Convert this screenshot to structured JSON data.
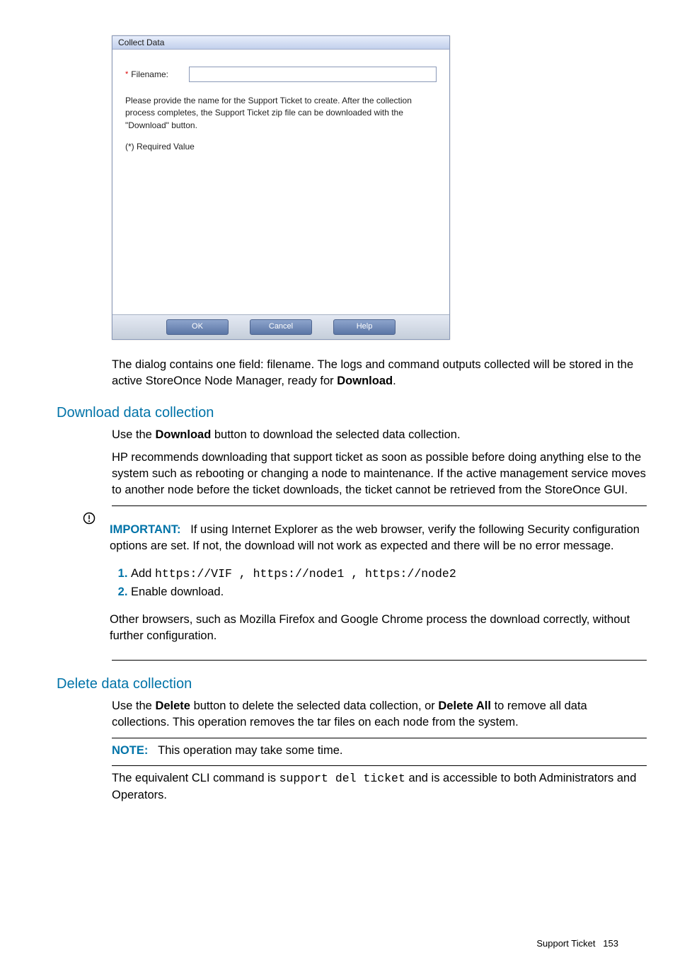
{
  "dialog": {
    "title": "Collect Data",
    "filename_label": "Filename:",
    "filename_value": "",
    "info": "Please provide the name for the Support Ticket to create. After the collection process completes, the Support Ticket zip file can be downloaded with the \"Download\" button.",
    "required_note": "(*) Required Value",
    "buttons": {
      "ok": "OK",
      "cancel": "Cancel",
      "help": "Help"
    }
  },
  "para_after_dialog_prefix": "The dialog contains one field: filename. The logs and command outputs collected will be stored in the active StoreOnce Node Manager, ready for ",
  "para_after_dialog_bold": "Download",
  "para_after_dialog_suffix": ".",
  "h_download": "Download data collection",
  "download_p1_a": "Use the ",
  "download_p1_bold": "Download",
  "download_p1_b": " button to download the selected data collection.",
  "download_p2": "HP recommends downloading that support ticket as soon as possible before doing anything else to the system such as rebooting or changing a node to maintenance. If the active management service moves to another node before the ticket downloads, the ticket cannot be retrieved from the StoreOnce GUI.",
  "important_label": "IMPORTANT:",
  "important_text": "If using Internet Explorer as the web browser, verify the following Security configuration options are set. If not, the download will not work as expected and there will be no error message.",
  "step1_prefix": "Add ",
  "step1_code": "https://VIF , https://node1 , https://node2",
  "step2": "Enable download.",
  "important_after": "Other browsers, such as Mozilla Firefox and Google Chrome process the download correctly, without further configuration.",
  "h_delete": "Delete data collection",
  "delete_p1_a": "Use the ",
  "delete_p1_b1": "Delete",
  "delete_p1_c": " button to delete the selected data collection, or ",
  "delete_p1_b2": "Delete All",
  "delete_p1_d": " to remove all data collections. This operation removes the tar files on each node from the system.",
  "note_label": "NOTE:",
  "note_text": "This operation may take some time.",
  "delete_p2_a": "The equivalent CLI command is ",
  "delete_p2_code": "support del ticket",
  "delete_p2_b": " and is accessible to both Administrators and Operators.",
  "footer_label": "Support Ticket",
  "footer_page": "153"
}
